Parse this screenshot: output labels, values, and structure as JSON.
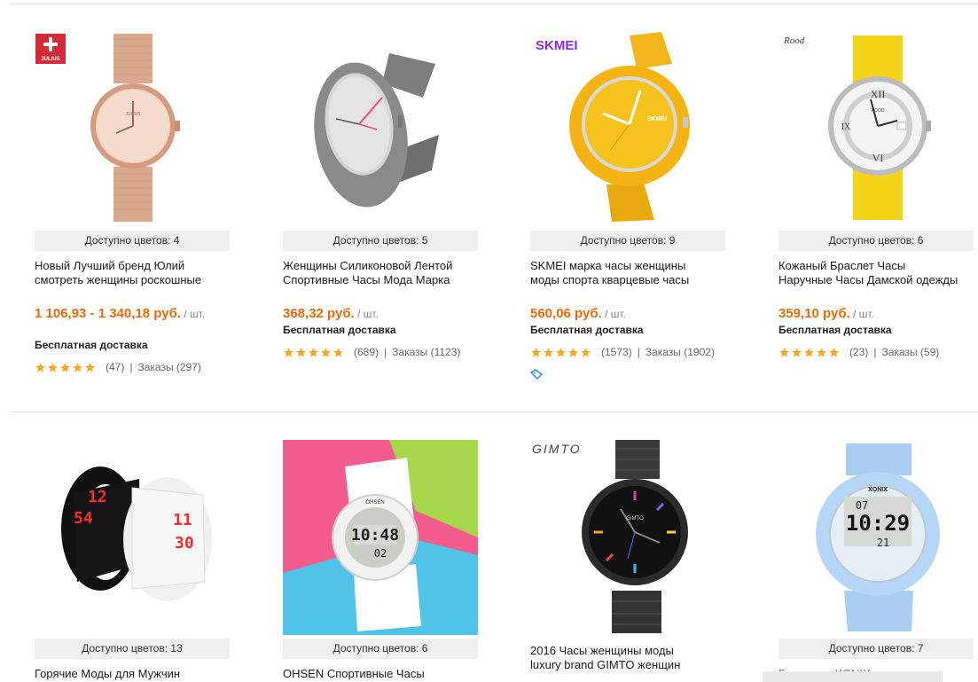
{
  "products": [
    {
      "brand": "JULIUS",
      "colors_label": "Доступно цветов: 4",
      "title_lines": [
        "Новый Лучший бренд Юлий",
        "смотреть женщины роскошные"
      ],
      "price": "1 106,93 - 1 340,18 руб.",
      "unit": " / шт.",
      "shipping": "Бесплатная доставка",
      "rating_count": "(47)",
      "orders": "Заказы (297)",
      "rating": 5
    },
    {
      "brand": "",
      "colors_label": "Доступно цветов: 5",
      "title_lines": [
        "Женщины Силиконовой Лентой",
        "Спортивные Часы Мода Марка"
      ],
      "price": "368,32 руб.",
      "unit": " / шт.",
      "shipping": "Бесплатная доставка",
      "rating_count": "(689)",
      "orders": "Заказы (1123)",
      "rating": 4.8
    },
    {
      "brand": "SKMEI",
      "colors_label": "Доступно цветов: 9",
      "title_lines": [
        "SKMEI марка часы женщины",
        "моды спорта кварцевые часы"
      ],
      "price": "560,06 руб.",
      "unit": " / шт.",
      "shipping": "Бесплатная доставка",
      "rating_count": "(1573)",
      "orders": "Заказы (1902)",
      "rating": 5
    },
    {
      "brand": "Rood",
      "colors_label": "Доступно цветов: 6",
      "title_lines": [
        "Кожаный Браслет Часы",
        "Наручные Часы Дамской одежды"
      ],
      "price": "359,10 руб.",
      "unit": " / шт.",
      "shipping": "Бесплатная доставка",
      "rating_count": "(23)",
      "orders": "Заказы (59)",
      "rating": 5
    },
    {
      "brand": "",
      "colors_label": "Доступно цветов: 13",
      "title_lines": [
        "Горячие Моды для Мужчин"
      ]
    },
    {
      "brand": "",
      "colors_label": "Доступно цветов: 6",
      "title_lines": [
        "OHSEN Спортивные Часы"
      ]
    },
    {
      "brand": "GIMTO",
      "colors_label": "",
      "title_lines": [
        "2016 Часы женщины моды",
        "luxury brand GIMTO женщин"
      ]
    },
    {
      "brand": "",
      "colors_label": "Доступно цветов: 7",
      "title_lines": [
        "Горячие... XONIX ..."
      ]
    }
  ],
  "watch_text": {
    "julius": "JULIUS",
    "skmei_dial": "SKMEI",
    "rood_dial": "ROOD",
    "led_top": "12",
    "led_bottom": "54",
    "led_top_white": "11",
    "led_bottom_white": "30",
    "ohsen_time": "10:48",
    "ohsen_sub": "02",
    "ohsen_brand": "OHSEN",
    "gimto_dial": "GIMTO",
    "xonix_brand": "XONIX",
    "xonix_top": "07",
    "xonix_time": "10:29",
    "xonix_sub": "21"
  },
  "colors": {
    "price": "#e96a0c",
    "star": "#f5a623",
    "colors_bar": "#efefef"
  }
}
